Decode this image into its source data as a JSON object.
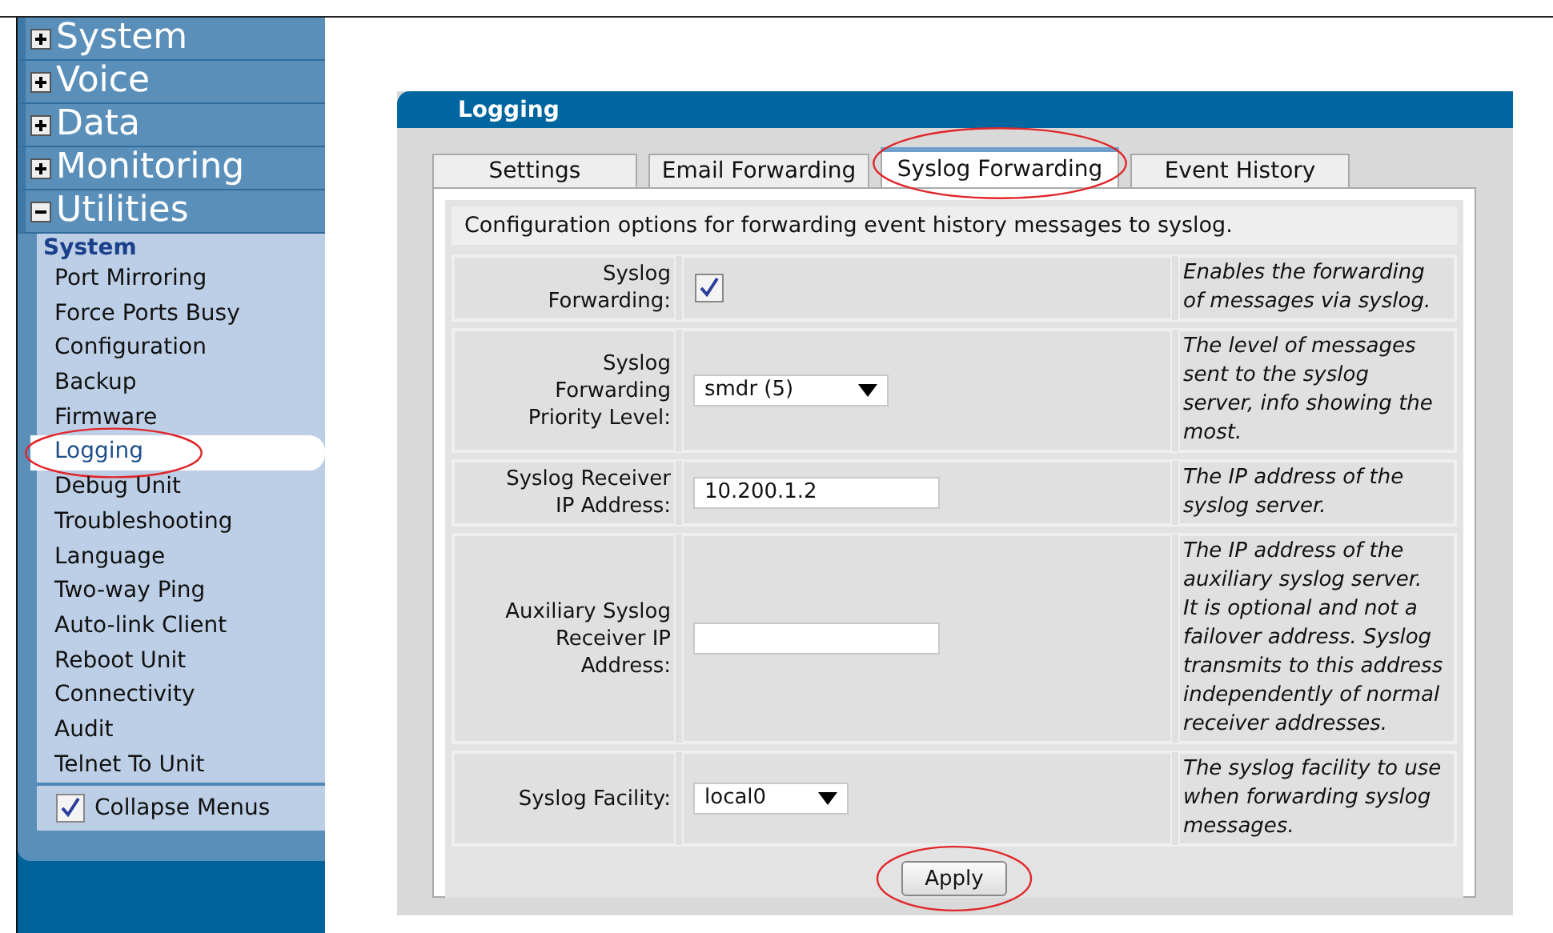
{
  "sidebar": {
    "sections": [
      {
        "label": "System",
        "expanded": false
      },
      {
        "label": "Voice",
        "expanded": false
      },
      {
        "label": "Data",
        "expanded": false
      },
      {
        "label": "Monitoring",
        "expanded": false
      },
      {
        "label": "Utilities",
        "expanded": true
      }
    ],
    "group_heading": "System",
    "items": [
      {
        "label": "Port Mirroring",
        "selected": false,
        "highlighted": false
      },
      {
        "label": "Force Ports Busy",
        "selected": false,
        "highlighted": false
      },
      {
        "label": "Configuration",
        "selected": false,
        "highlighted": false
      },
      {
        "label": "Backup",
        "selected": false,
        "highlighted": false
      },
      {
        "label": "Firmware",
        "selected": false,
        "highlighted": false
      },
      {
        "label": "Logging",
        "selected": true,
        "highlighted": true
      },
      {
        "label": "Debug Unit",
        "selected": false,
        "highlighted": false
      },
      {
        "label": "Troubleshooting",
        "selected": false,
        "highlighted": false
      },
      {
        "label": "Language",
        "selected": false,
        "highlighted": false
      },
      {
        "label": "Two-way Ping",
        "selected": false,
        "highlighted": false
      },
      {
        "label": "Auto-link Client",
        "selected": false,
        "highlighted": false
      },
      {
        "label": "Reboot Unit",
        "selected": false,
        "highlighted": false
      },
      {
        "label": "Connectivity",
        "selected": false,
        "highlighted": false
      },
      {
        "label": "Audit",
        "selected": false,
        "highlighted": false
      },
      {
        "label": "Telnet To Unit",
        "selected": false,
        "highlighted": false
      }
    ],
    "collapse_menus": {
      "label": "Collapse Menus",
      "checked": true
    }
  },
  "panel": {
    "title": "Logging",
    "tabs": [
      {
        "label": "Settings",
        "selected": false,
        "highlighted": false
      },
      {
        "label": "Email Forwarding",
        "selected": false,
        "highlighted": false
      },
      {
        "label": "Syslog Forwarding",
        "selected": true,
        "highlighted": true
      },
      {
        "label": "Event History",
        "selected": false,
        "highlighted": false
      }
    ],
    "description": "Configuration options for forwarding event history messages to syslog.",
    "fields": [
      {
        "kind": "checkbox",
        "label": "Syslog\nForwarding:",
        "checked": true,
        "help": "Enables the forwarding\nof messages via syslog."
      },
      {
        "kind": "select",
        "label": "Syslog\nForwarding\nPriority Level:",
        "value": "smdr (5)",
        "help": "The level of messages\nsent to the syslog\nserver, info showing the\nmost."
      },
      {
        "kind": "text",
        "label": "Syslog Receiver\nIP Address:",
        "value": "10.200.1.2",
        "help": "The IP address of the\nsyslog server."
      },
      {
        "kind": "text",
        "label": "Auxiliary Syslog\nReceiver IP\nAddress:",
        "help": "The IP address of the\nauxiliary syslog server.\nIt is optional and not a\nfailover address. Syslog\ntransmits to this address\nindependently of normal\nreceiver addresses."
      },
      {
        "kind": "select_short",
        "label": "Syslog Facility:",
        "value": "local0",
        "help": "The syslog facility to use\nwhen forwarding syslog\nmessages."
      }
    ],
    "apply": {
      "label": "Apply",
      "highlighted": true
    }
  }
}
